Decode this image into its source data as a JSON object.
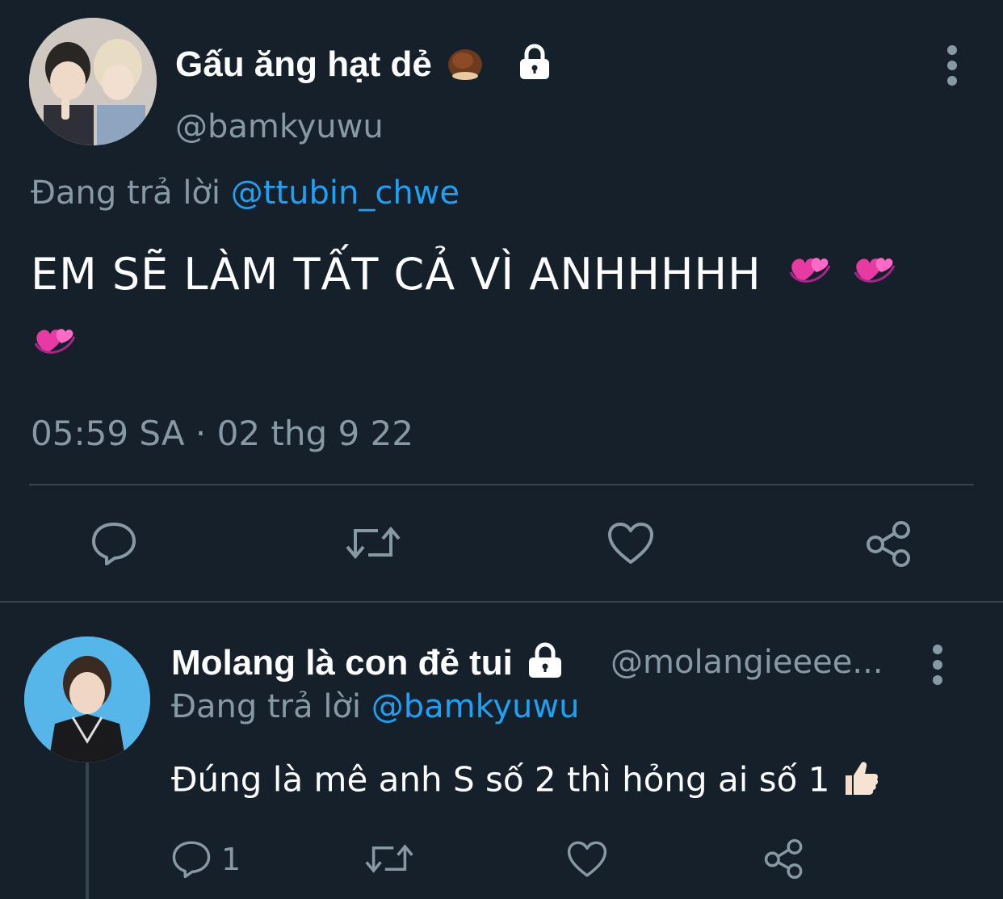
{
  "tweet": {
    "display_name": "Gấu ăng hạt dẻ",
    "handle": "@bamkyuwu",
    "reply_prefix": "Đang trả lời",
    "reply_to": "@ttubin_chwe",
    "text": "EM SẼ LÀM TẤT CẢ VÌ ANHHHHH",
    "emojis": [
      "heart-swirl",
      "heart-swirl",
      "heart-swirl"
    ],
    "timestamp": "05:59 SA · 02 thg 9 22",
    "actions": [
      "reply-icon",
      "retweet-icon",
      "like-icon",
      "share-icon"
    ]
  },
  "reply": {
    "display_name": "Molang là con đẻ tui",
    "handle": "@molangieeee...",
    "reply_prefix": "Đang trả lời",
    "reply_to": "@bamkyuwu",
    "text": "Đúng là mê anh S số 2 thì hỏng ai số 1",
    "reply_count": "1"
  },
  "colors": {
    "background": "#15202b",
    "secondary_text": "#8899a6",
    "mention": "#1da1f2",
    "divider": "#38444d"
  }
}
